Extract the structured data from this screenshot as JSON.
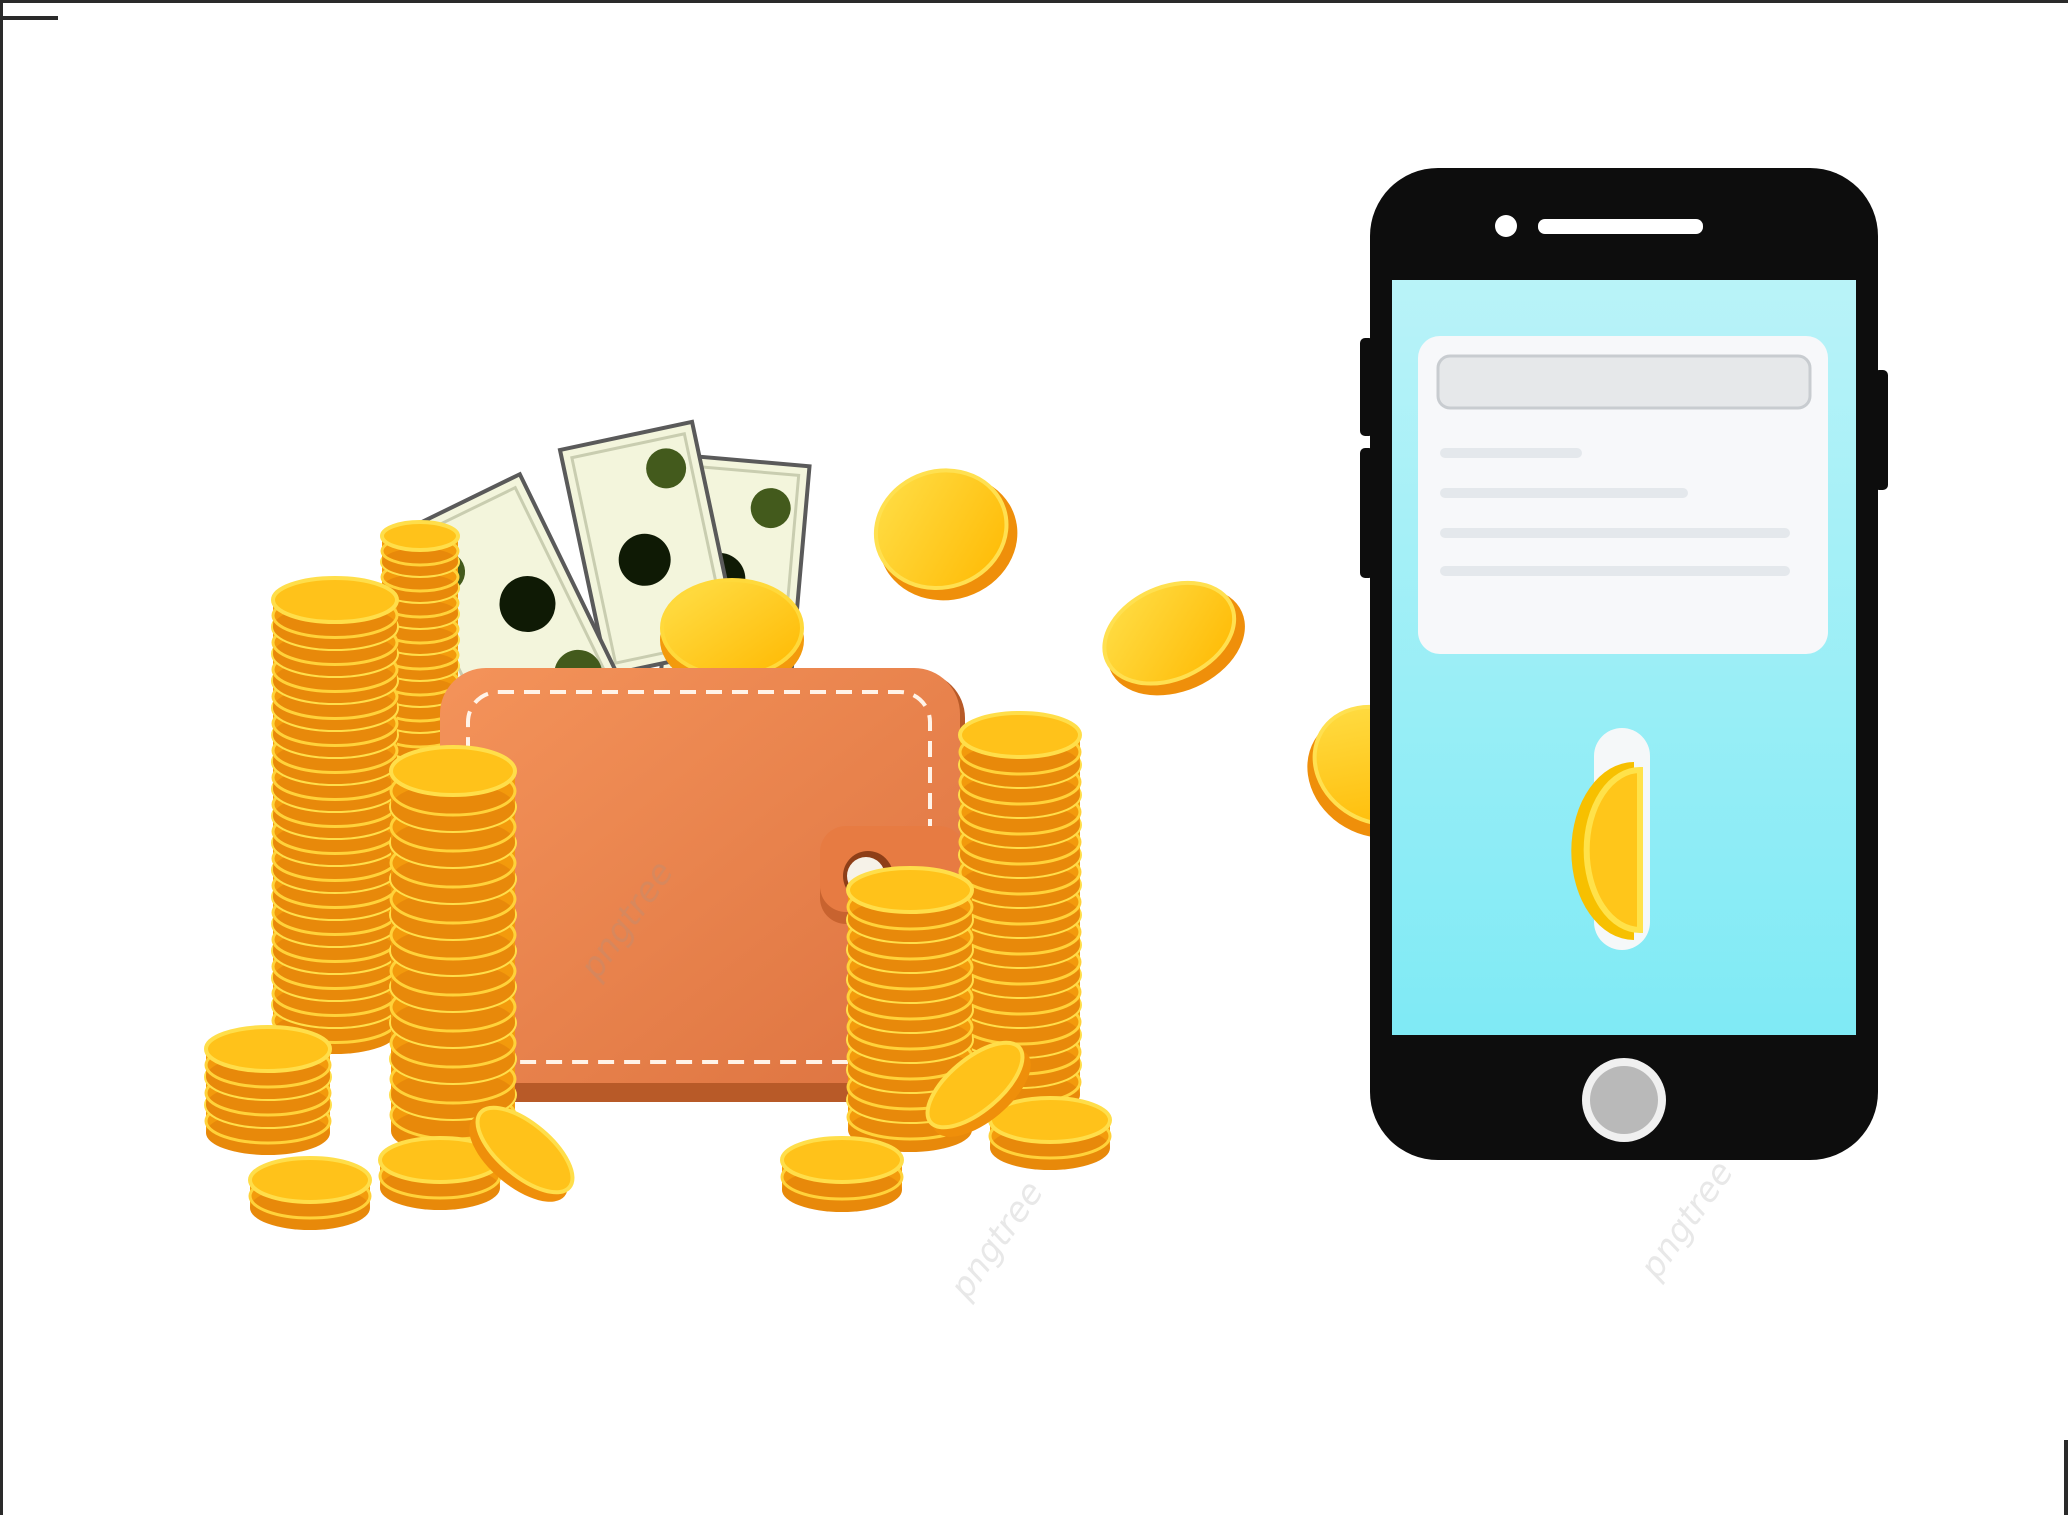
{
  "scene": {
    "description_icons": [
      "wallet-icon",
      "banknote-icon",
      "gold-coin-icon",
      "smartphone-icon"
    ],
    "watermark_text": "pngtree",
    "colors": {
      "wallet": "#e9824d",
      "wallet_dark": "#c1622e",
      "coin": "#ffc21a",
      "coin_edge": "#f39a0c",
      "banknote": "#f4f6dd",
      "banknote_spot": "#445a1c",
      "phone_body": "#0d0d0d",
      "phone_screen": "#86edf7",
      "card": "#f7f8fa"
    }
  }
}
